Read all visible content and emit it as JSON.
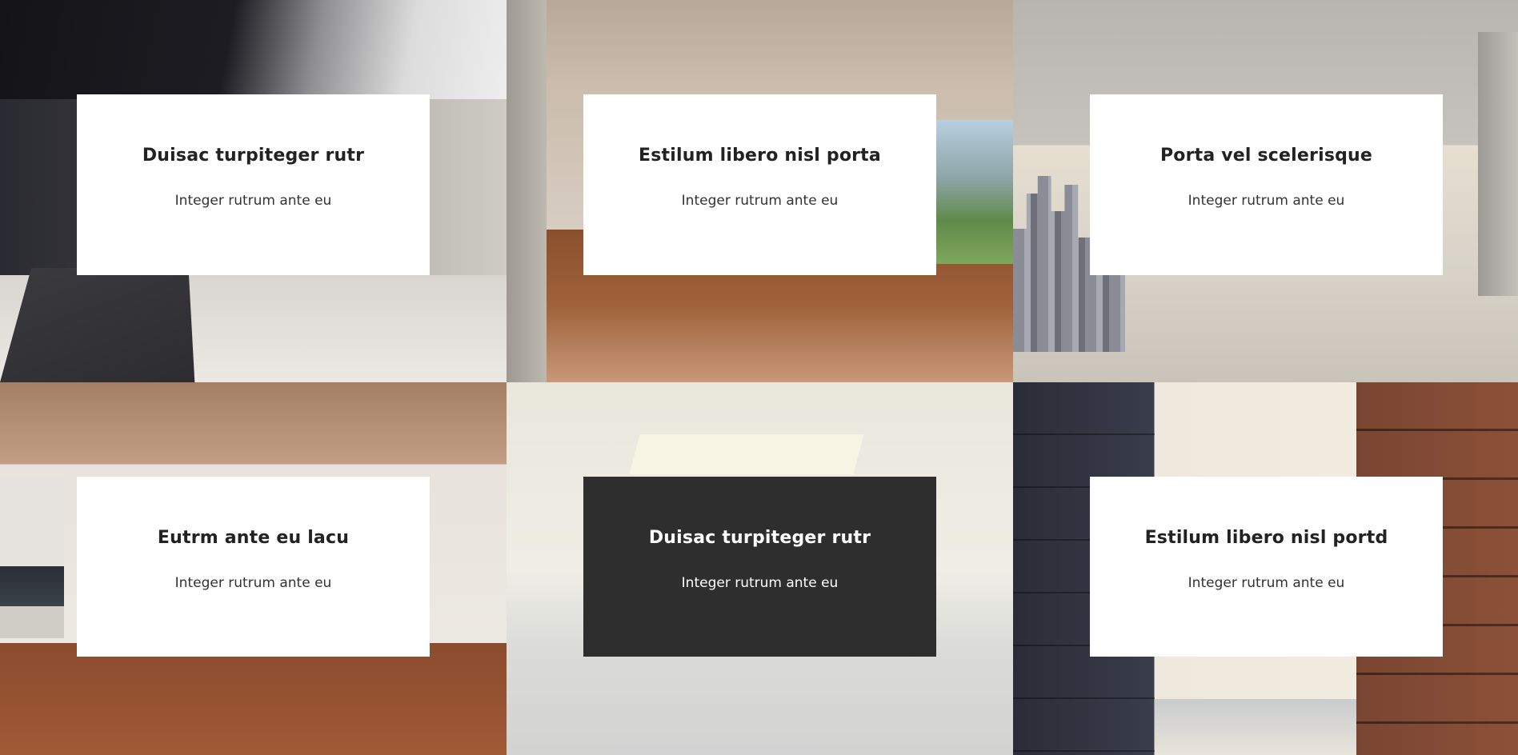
{
  "cards": [
    {
      "title": "Duisac turpiteger rutr",
      "subtitle": "Integer rutrum ante eu",
      "style": "light"
    },
    {
      "title": "Estilum libero nisl porta",
      "subtitle": "Integer rutrum ante eu",
      "style": "light"
    },
    {
      "title": "Porta vel scelerisque",
      "subtitle": "Integer rutrum ante eu",
      "style": "light"
    },
    {
      "title": "Eutrm ante eu lacu",
      "subtitle": "Integer rutrum ante eu",
      "style": "light"
    },
    {
      "title": "Duisac turpiteger rutr",
      "subtitle": "Integer rutrum ante eu",
      "style": "dark"
    },
    {
      "title": "Estilum libero nisl portd",
      "subtitle": "Integer rutrum ante eu",
      "style": "light"
    }
  ],
  "colors": {
    "card_light": "#ffffff",
    "card_dark": "#2e2e2e",
    "text_dark": "#222222",
    "text_light": "#ffffff"
  }
}
